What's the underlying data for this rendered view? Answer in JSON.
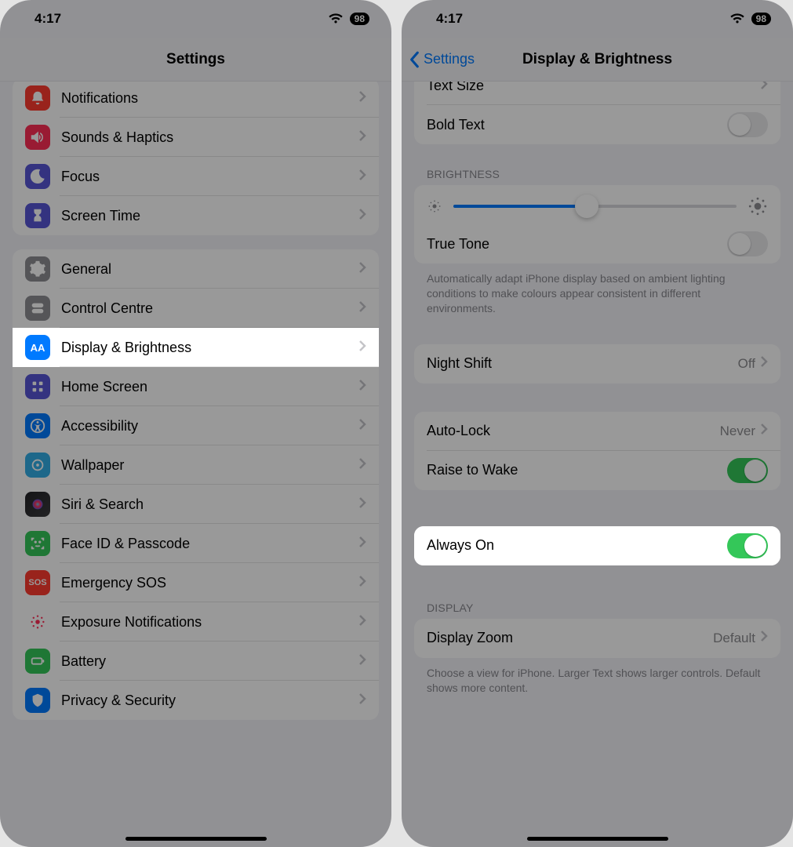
{
  "status": {
    "time": "4:17",
    "battery": "98"
  },
  "left": {
    "title": "Settings",
    "rows": {
      "notifications": "Notifications",
      "sounds": "Sounds & Haptics",
      "focus": "Focus",
      "screentime": "Screen Time",
      "general": "General",
      "control": "Control Centre",
      "display": "Display & Brightness",
      "home": "Home Screen",
      "accessibility": "Accessibility",
      "wallpaper": "Wallpaper",
      "siri": "Siri & Search",
      "faceid": "Face ID & Passcode",
      "sos": "Emergency SOS",
      "exposure": "Exposure Notifications",
      "battery": "Battery",
      "privacy": "Privacy & Security"
    }
  },
  "right": {
    "back": "Settings",
    "title": "Display & Brightness",
    "rows": {
      "textsize": "Text Size",
      "bold": "Bold Text",
      "bright_head": "BRIGHTNESS",
      "truetone": "True Tone",
      "tt_foot": "Automatically adapt iPhone display based on ambient lighting conditions to make colours appear consistent in different environments.",
      "night": "Night Shift",
      "night_val": "Off",
      "autolock": "Auto-Lock",
      "autolock_val": "Never",
      "raise": "Raise to Wake",
      "always": "Always On",
      "disp_head": "DISPLAY",
      "zoom": "Display Zoom",
      "zoom_val": "Default",
      "zoom_foot": "Choose a view for iPhone. Larger Text shows larger controls. Default shows more content."
    },
    "brightness_pct": 47
  }
}
